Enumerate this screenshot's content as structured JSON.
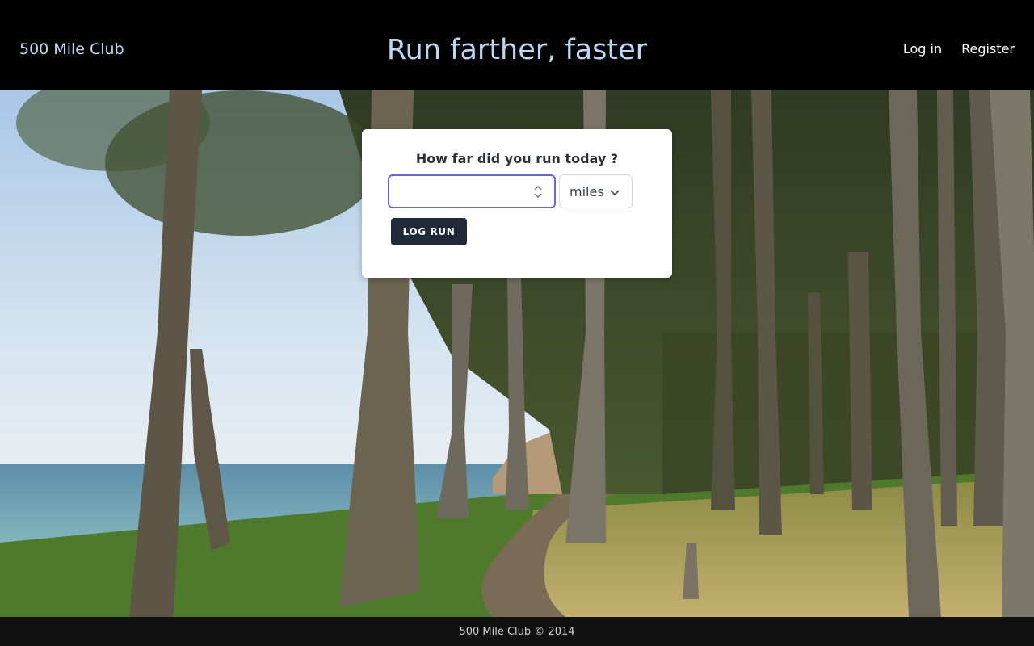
{
  "header": {
    "brand": "500 Mile Club",
    "title": "Run farther, faster",
    "nav": {
      "login": "Log in",
      "register": "Register"
    }
  },
  "form": {
    "question": "How far did you run today ?",
    "distance_value": "",
    "unit_selected": "miles",
    "submit_label": "LOG RUN"
  },
  "footer": {
    "text": "500 Mile Club © 2014"
  },
  "colors": {
    "header_bg": "#000000",
    "accent_text": "#bcd7f5",
    "input_focus": "#6b67d6",
    "button_bg": "#1f2937"
  },
  "icons": {
    "spinner": "number-spinner-icon",
    "select_arrow": "chevron-down-icon"
  }
}
